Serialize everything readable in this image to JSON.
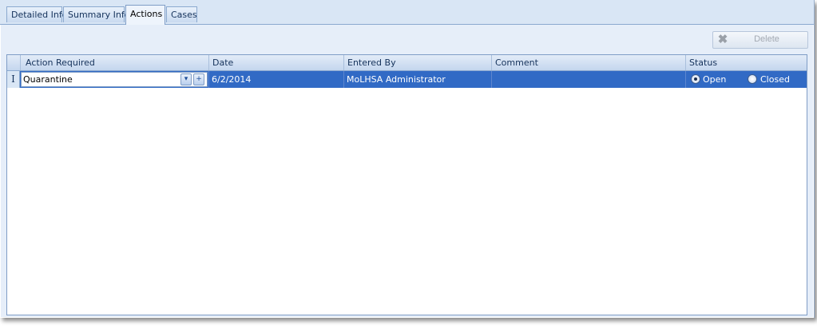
{
  "tabs": [
    {
      "label": "Detailed Info"
    },
    {
      "label": "Summary Info"
    },
    {
      "label": "Actions"
    },
    {
      "label": "Cases"
    }
  ],
  "active_tab": "Actions",
  "toolbar": {
    "delete_label": "Delete",
    "delete_icon": "delete-x-icon",
    "delete_enabled": false
  },
  "grid": {
    "columns": [
      {
        "label": "Action Required"
      },
      {
        "label": "Date"
      },
      {
        "label": "Entered By"
      },
      {
        "label": "Comment"
      },
      {
        "label": "Status"
      }
    ],
    "rows": [
      {
        "action_required": "Quarantine",
        "date": "6/2/2014",
        "entered_by": "MoLHSA Administrator",
        "comment": "",
        "status": {
          "selected": "Open",
          "options": [
            "Open",
            "Closed"
          ]
        },
        "row_indicator": "I"
      }
    ]
  },
  "colors": {
    "selection": "#316ac5",
    "tab_strip": "#d9e6f5",
    "panel": "#e6eef9",
    "border": "#8ba9cf"
  }
}
